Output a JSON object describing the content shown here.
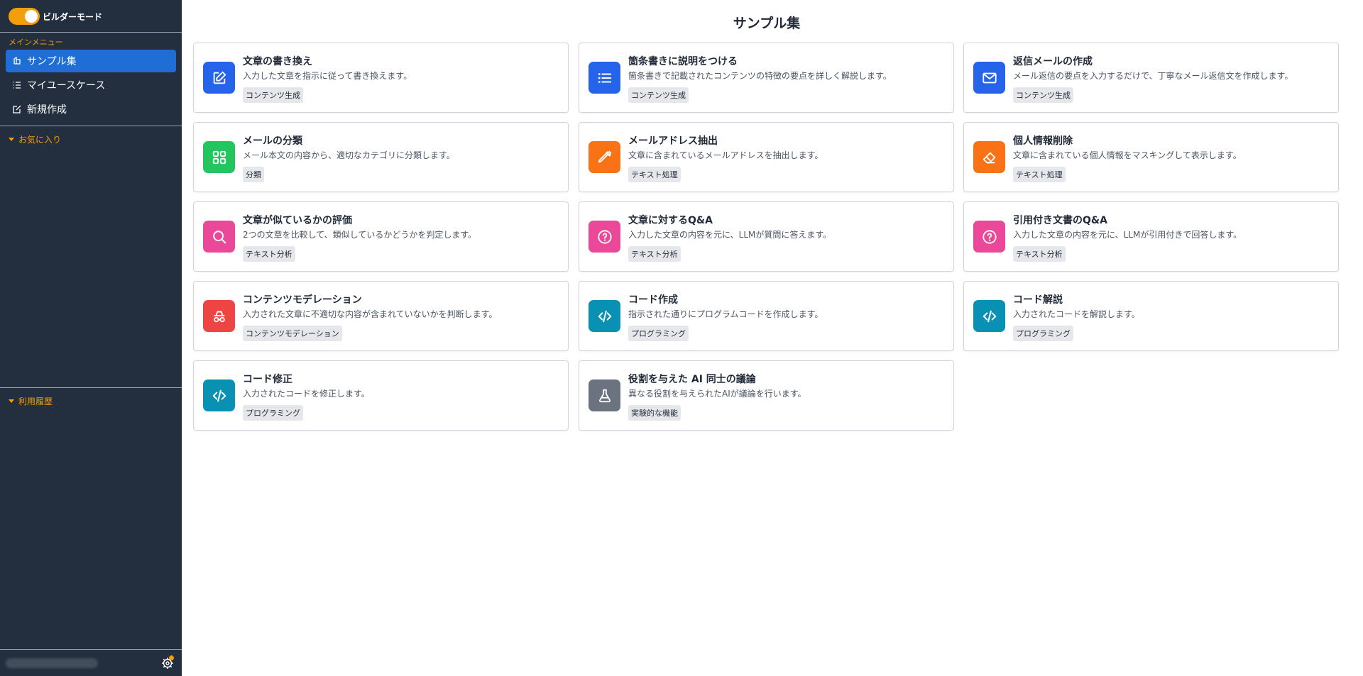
{
  "sidebar": {
    "builder_mode_label": "ビルダーモード",
    "main_menu_label": "メインメニュー",
    "items": [
      {
        "label": "サンプル集",
        "icon": "sample-icon",
        "active": true
      },
      {
        "label": "マイユースケース",
        "icon": "list-icon",
        "active": false
      },
      {
        "label": "新規作成",
        "icon": "edit-icon",
        "active": false
      }
    ],
    "favorites_label": "お気に入り",
    "history_label": "利用履歴"
  },
  "main": {
    "title": "サンプル集",
    "cards": [
      {
        "title": "文章の書き換え",
        "description": "入力した文章を指示に従って書き換えます。",
        "tag": "コンテンツ生成",
        "icon": "edit-icon",
        "color": "#2563eb"
      },
      {
        "title": "箇条書きに説明をつける",
        "description": "箇条書きで記載されたコンテンツの特徴の要点を詳しく解説します。",
        "tag": "コンテンツ生成",
        "icon": "list-icon",
        "color": "#2563eb"
      },
      {
        "title": "返信メールの作成",
        "description": "メール返信の要点を入力するだけで、丁寧なメール返信文を作成します。",
        "tag": "コンテンツ生成",
        "icon": "mail-icon",
        "color": "#2563eb"
      },
      {
        "title": "メールの分類",
        "description": "メール本文の内容から、適切なカテゴリに分類します。",
        "tag": "分類",
        "icon": "grid-icon",
        "color": "#22c55e"
      },
      {
        "title": "メールアドレス抽出",
        "description": "文章に含まれているメールアドレスを抽出します。",
        "tag": "テキスト処理",
        "icon": "eyedropper-icon",
        "color": "#f97316"
      },
      {
        "title": "個人情報削除",
        "description": "文章に含まれている個人情報をマスキングして表示します。",
        "tag": "テキスト処理",
        "icon": "eraser-icon",
        "color": "#f97316"
      },
      {
        "title": "文章が似ているかの評価",
        "description": "2つの文章を比較して、類似しているかどうかを判定します。",
        "tag": "テキスト分析",
        "icon": "search-icon",
        "color": "#ec4899"
      },
      {
        "title": "文章に対するQ&A",
        "description": "入力した文章の内容を元に、LLMが質問に答えます。",
        "tag": "テキスト分析",
        "icon": "question-icon",
        "color": "#ec4899"
      },
      {
        "title": "引用付き文書のQ&A",
        "description": "入力した文章の内容を元に、LLMが引用付きで回答します。",
        "tag": "テキスト分析",
        "icon": "question-icon",
        "color": "#ec4899"
      },
      {
        "title": "コンテンツモデレーション",
        "description": "入力された文章に不適切な内容が含まれていないかを判断します。",
        "tag": "コンテンツモデレーション",
        "icon": "incognito-icon",
        "color": "#ef4444"
      },
      {
        "title": "コード作成",
        "description": "指示された通りにプログラムコードを作成します。",
        "tag": "プログラミング",
        "icon": "code-icon",
        "color": "#0891b2"
      },
      {
        "title": "コード解説",
        "description": "入力されたコードを解説します。",
        "tag": "プログラミング",
        "icon": "code-icon",
        "color": "#0891b2"
      },
      {
        "title": "コード修正",
        "description": "入力されたコードを修正します。",
        "tag": "プログラミング",
        "icon": "code-icon",
        "color": "#0891b2"
      },
      {
        "title": "役割を与えた AI 同士の議論",
        "description": "異なる役割を与えられたAIが議論を行います。",
        "tag": "実験的な機能",
        "icon": "flask-icon",
        "color": "#6b7280"
      }
    ]
  }
}
